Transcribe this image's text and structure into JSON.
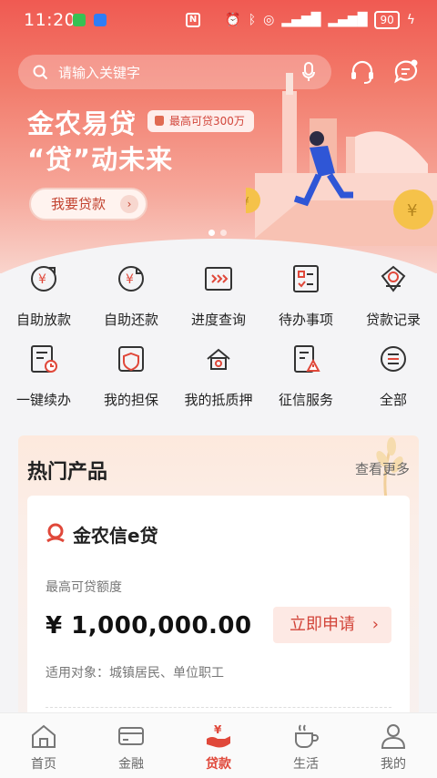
{
  "status": {
    "time": "11:20",
    "battery": "90"
  },
  "search": {
    "placeholder": "请输入关键字"
  },
  "banner": {
    "title": "金农易贷",
    "tag": "最高可贷300万",
    "subtitle": "“贷”动未来",
    "button": "我要贷款"
  },
  "grid": [
    {
      "label": "自助放款",
      "icon": "self-disburse-icon"
    },
    {
      "label": "自助还款",
      "icon": "self-repay-icon"
    },
    {
      "label": "进度查询",
      "icon": "progress-query-icon"
    },
    {
      "label": "待办事项",
      "icon": "todo-icon"
    },
    {
      "label": "贷款记录",
      "icon": "loan-record-icon"
    },
    {
      "label": "一键续办",
      "icon": "renew-icon"
    },
    {
      "label": "我的担保",
      "icon": "guarantee-icon"
    },
    {
      "label": "我的抵质押",
      "icon": "collateral-icon"
    },
    {
      "label": "征信服务",
      "icon": "credit-service-icon"
    },
    {
      "label": "全部",
      "icon": "all-icon"
    }
  ],
  "hot": {
    "title": "热门产品",
    "more": "查看更多",
    "product": {
      "name": "金农信e贷",
      "quota_label": "最高可贷额度",
      "amount": "¥ 1,000,000.00",
      "apply": "立即申请",
      "target": "适用对象：城镇居民、单位职工"
    }
  },
  "nav": [
    {
      "label": "首页",
      "icon": "home-icon",
      "active": false
    },
    {
      "label": "金融",
      "icon": "card-icon",
      "active": false
    },
    {
      "label": "贷款",
      "icon": "loan-icon",
      "active": true
    },
    {
      "label": "生活",
      "icon": "coffee-icon",
      "active": false
    },
    {
      "label": "我的",
      "icon": "user-icon",
      "active": false
    }
  ],
  "colors": {
    "accent": "#e0483a",
    "hero_top": "#f05a52"
  }
}
